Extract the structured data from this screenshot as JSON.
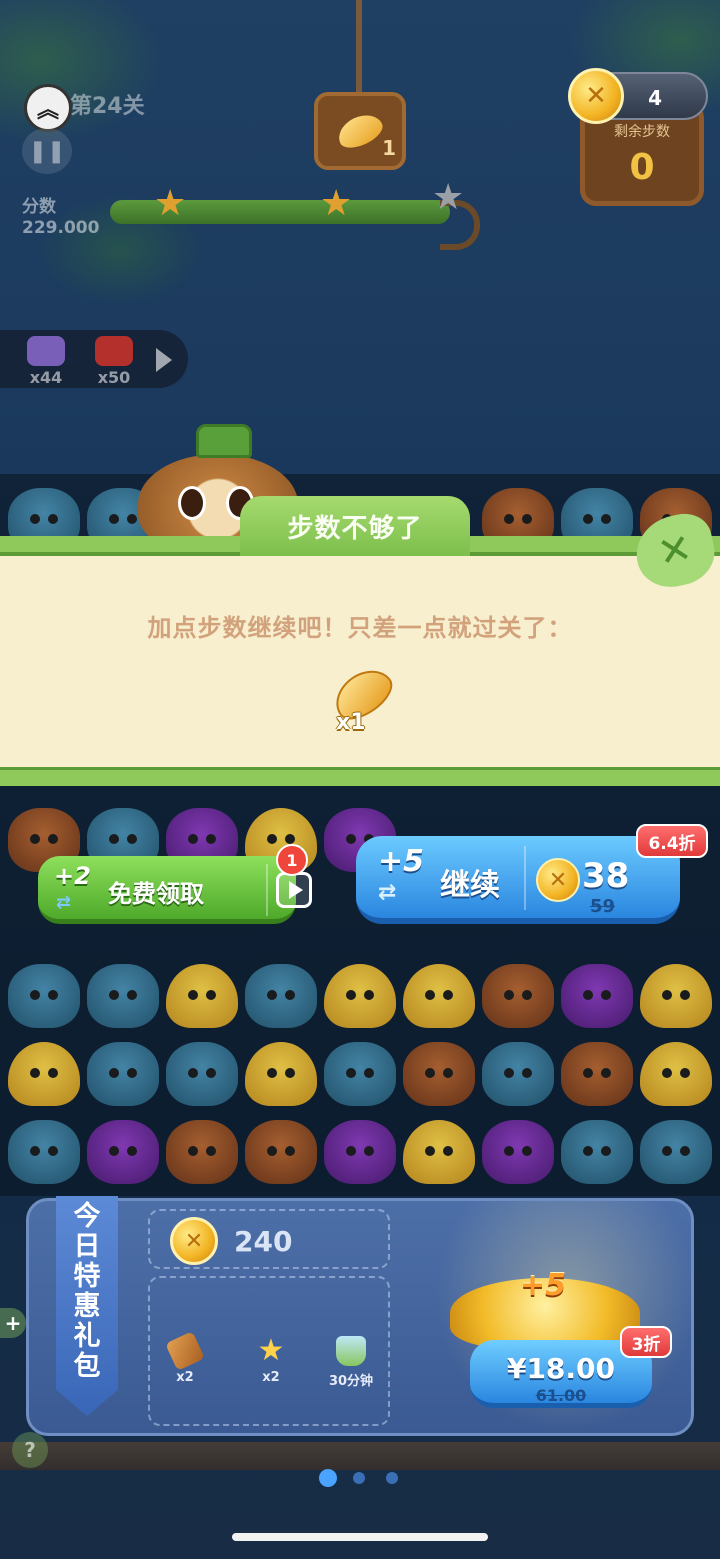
{
  "hud": {
    "level_text": "第24关",
    "score_label": "分数",
    "score_value": "229.000",
    "target_count": "1",
    "moves_label": "剩余步数",
    "moves_value": "0",
    "coins": "4",
    "stars_earned": 2,
    "stars_total": 3
  },
  "items": [
    {
      "icon": "purple-box-icon",
      "count": "x44"
    },
    {
      "icon": "red-box-icon",
      "count": "x50"
    }
  ],
  "dialog": {
    "title": "步数不够了",
    "message": "加点步数继续吧！只差一点就过关了：",
    "needed_item": {
      "icon": "bean-icon",
      "count": "x1"
    }
  },
  "actions": {
    "free": {
      "plus": "+2",
      "label": "免费领取",
      "badge": "1"
    },
    "continue": {
      "plus": "+5",
      "label": "继续",
      "price": "38",
      "old_price": "59",
      "discount": "6.4折"
    }
  },
  "gift": {
    "title_chars": [
      "今",
      "日",
      "特",
      "惠",
      "礼",
      "包"
    ],
    "coins": "240",
    "items": [
      {
        "icon": "hammer-icon",
        "label": "x2"
      },
      {
        "icon": "star-wand-icon",
        "label": "x2"
      },
      {
        "icon": "bottle-icon",
        "label": "30分钟"
      }
    ],
    "bonus": "+5",
    "price": "¥18.00",
    "old_price": "61.00",
    "discount": "3折"
  },
  "pagination": {
    "count": 3,
    "active": 0
  },
  "colors": {
    "dialog_bg": "#f8efcf",
    "dialog_border": "#8fc95b",
    "free_button": "#4fa92a",
    "continue_button": "#2a86df",
    "discount_red": "#e03a3a"
  }
}
